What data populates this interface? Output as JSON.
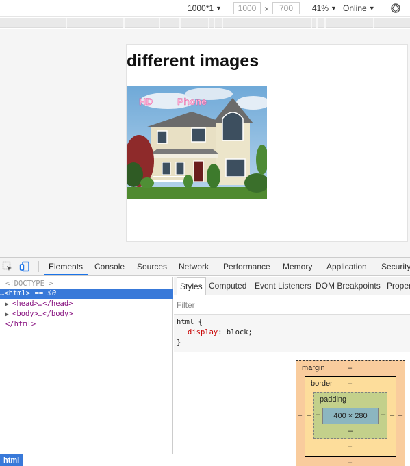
{
  "device_toolbar": {
    "dimensions_label": "1000*1",
    "width_value": "1000",
    "height_value": "700",
    "separator": "×",
    "zoom_label": "41%",
    "throttle_label": "Online"
  },
  "page": {
    "heading": "different images",
    "image_overlay_left": "HD",
    "image_overlay_right": "Phone"
  },
  "devtools": {
    "tabs": [
      "Elements",
      "Console",
      "Sources",
      "Network",
      "Performance",
      "Memory",
      "Application",
      "Security"
    ],
    "active_tab": "Elements",
    "elements": {
      "doctype": "<!DOCTYPE >",
      "html_open": "<html>",
      "selected_suffix": " == $0",
      "head": "<head>…</head>",
      "body": "<body>…</body>",
      "html_close": "</html>",
      "breadcrumb": "html"
    },
    "styles_tabs": [
      "Styles",
      "Computed",
      "Event Listeners",
      "DOM Breakpoints",
      "Proper"
    ],
    "filter_placeholder": "Filter",
    "rule": {
      "selector_line": "html {",
      "property": "display",
      "value": "block;",
      "close": "}"
    },
    "box_model": {
      "margin_label": "margin",
      "border_label": "border",
      "padding_label": "padding",
      "content_size": "400 × 280",
      "dash": "–"
    }
  },
  "colors": {
    "selection_blue": "#3879d9",
    "active_tab_underline": "#1a73e8",
    "margin_fill": "#f9cc9d",
    "border_fill": "#fddd9b",
    "padding_fill": "#c3d08b",
    "content_fill": "#8cb6c0"
  }
}
